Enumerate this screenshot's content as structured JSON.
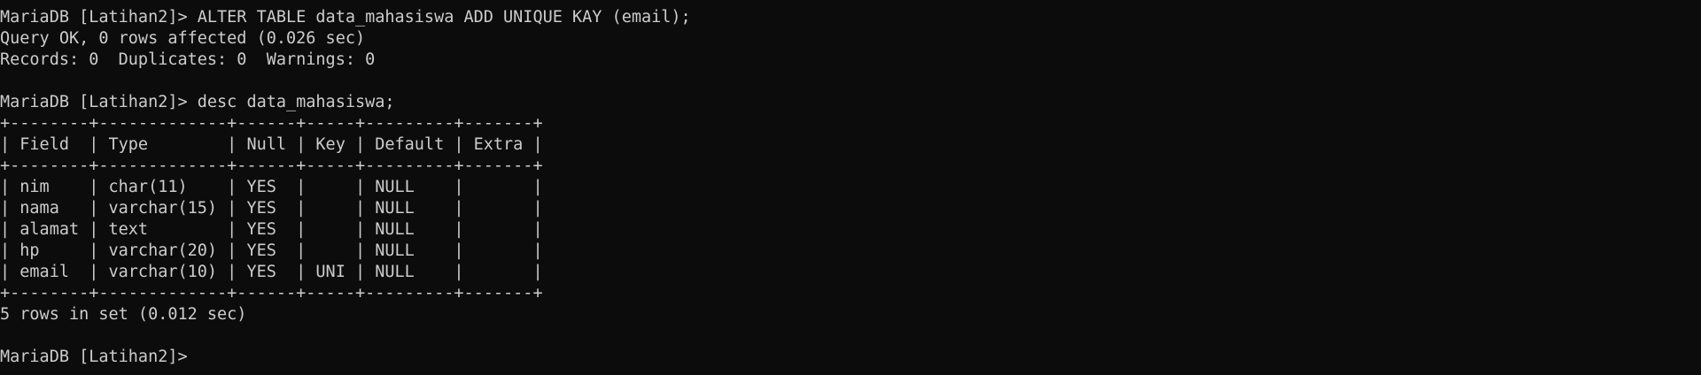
{
  "terminal": {
    "lines": [
      "MariaDB [Latihan2]> ALTER TABLE data_mahasiswa ADD UNIQUE KAY (email);",
      "Query OK, 0 rows affected (0.026 sec)",
      "Records: 0  Duplicates: 0  Warnings: 0",
      "",
      "MariaDB [Latihan2]> desc data_mahasiswa;",
      "+--------+-------------+------+-----+---------+-------+",
      "| Field  | Type        | Null | Key | Default | Extra |",
      "+--------+-------------+------+-----+---------+-------+",
      "| nim    | char(11)    | YES  |     | NULL    |       |",
      "| nama   | varchar(15) | YES  |     | NULL    |       |",
      "| alamat | text        | YES  |     | NULL    |       |",
      "| hp     | varchar(20) | YES  |     | NULL    |       |",
      "| email  | varchar(10) | YES  | UNI | NULL    |       |",
      "+--------+-------------+------+-----+---------+-------+",
      "5 rows in set (0.012 sec)",
      "",
      "MariaDB [Latihan2]>"
    ],
    "colors": {
      "background": "#0c0c0c",
      "foreground": "#cccccc"
    }
  }
}
